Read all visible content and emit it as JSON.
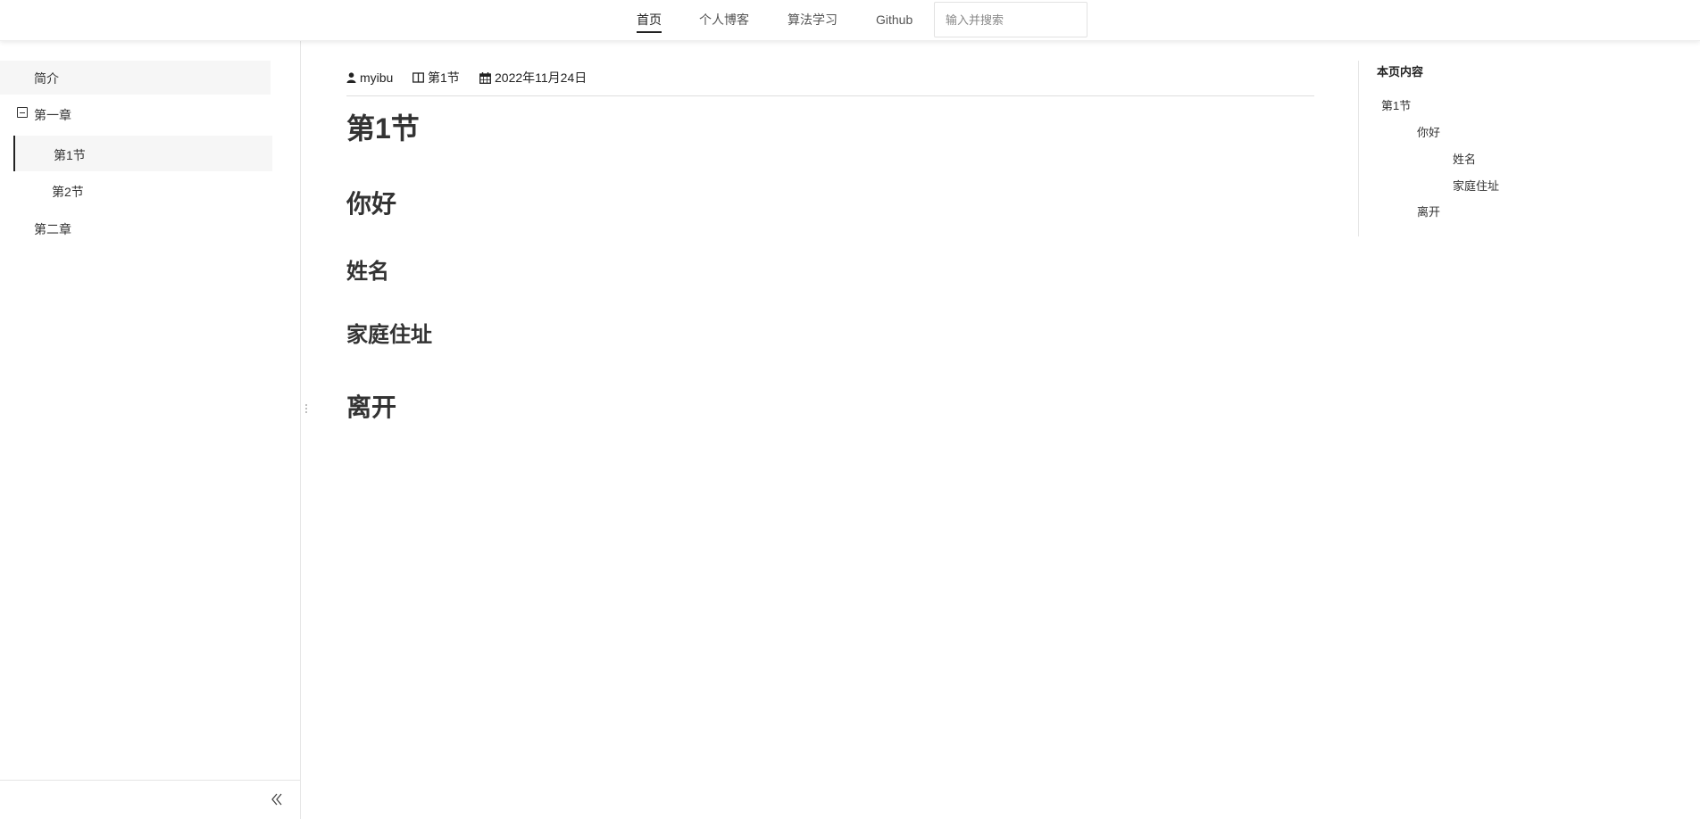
{
  "nav": {
    "links": [
      {
        "label": "首页",
        "active": true
      },
      {
        "label": "个人博客",
        "active": false
      },
      {
        "label": "算法学习",
        "active": false
      },
      {
        "label": "Github",
        "active": false
      }
    ],
    "search_placeholder": "输入并搜索"
  },
  "sidebar": {
    "items": [
      {
        "label": "简介"
      },
      {
        "label": "第一章",
        "icon": "minus-square-icon",
        "expanded": true
      },
      {
        "label": "第1节",
        "active": true
      },
      {
        "label": "第2节"
      },
      {
        "label": "第二章"
      }
    ],
    "footer_icon": "double-chevron-left-icon"
  },
  "article": {
    "meta": {
      "author": "myibu",
      "section": "第1节",
      "date": "2022年11月24日"
    },
    "headings": [
      {
        "text": "第1节",
        "level": 1
      },
      {
        "text": "你好",
        "level": 2
      },
      {
        "text": "姓名",
        "level": 3
      },
      {
        "text": "家庭住址",
        "level": 3
      },
      {
        "text": "离开",
        "level": 2
      }
    ]
  },
  "toc": {
    "title": "本页内容",
    "items": [
      {
        "label": "第1节",
        "depth": 1
      },
      {
        "label": "你好",
        "depth": 2
      },
      {
        "label": "姓名",
        "depth": 3
      },
      {
        "label": "家庭住址",
        "depth": 3
      },
      {
        "label": "离开",
        "depth": 2
      }
    ]
  },
  "colors": {
    "text": "#333333",
    "active": "#222222",
    "sidebar_highlight": "#f6f6f6",
    "border": "#e5e5e5"
  }
}
